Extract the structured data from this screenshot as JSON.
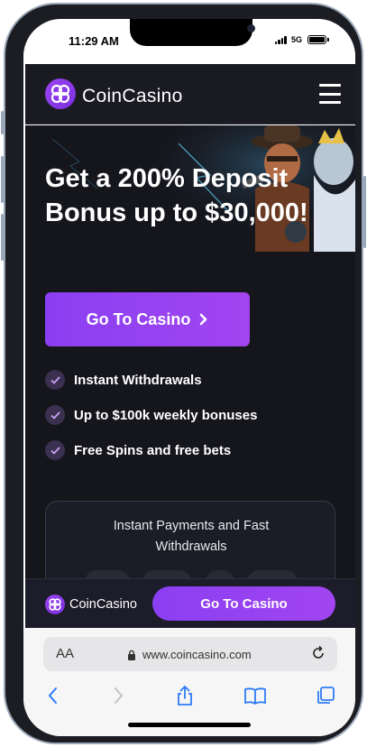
{
  "status_bar": {
    "time": "11:29 AM",
    "network": "5G"
  },
  "site": {
    "brand": "CoinCasino",
    "menu_icon": "hamburger-menu-icon",
    "accent": "#9b44f0"
  },
  "hero": {
    "headline": "Get a 200% Deposit Bonus up to $30,000!",
    "cta_label": "Go To Casino",
    "features": [
      "Instant Withdrawals",
      "Up to $100k weekly bonuses",
      "Free Spins and free bets"
    ],
    "payments_title": "Instant Payments and Fast Withdrawals"
  },
  "sticky_bar": {
    "brand": "CoinCasino",
    "cta_label": "Go To Casino"
  },
  "browser": {
    "text_size_label": "AA",
    "url": "www.coincasino.com"
  }
}
